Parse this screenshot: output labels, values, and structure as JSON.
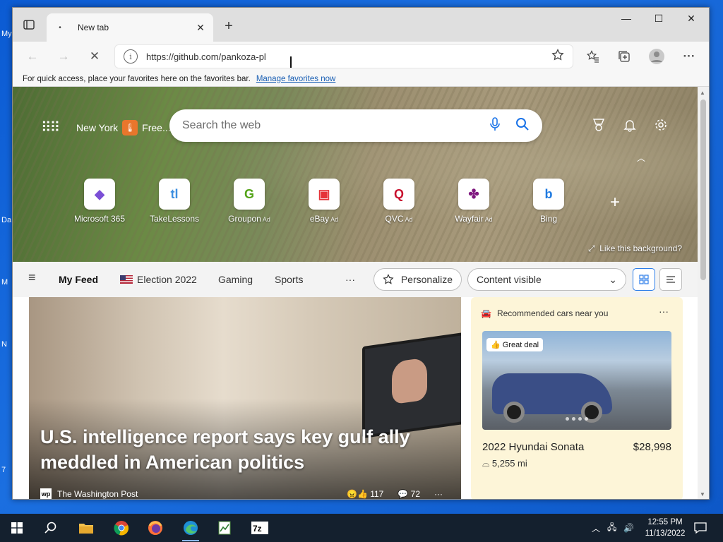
{
  "desktop": {
    "letters": [
      "My",
      "Da",
      "M",
      "N",
      "7"
    ]
  },
  "browser": {
    "tab": {
      "title": "New tab",
      "dot": "•",
      "close": "✕"
    },
    "new_tab": "+",
    "window_controls": {
      "minimize": "—",
      "maximize": "☐",
      "close": "✕"
    },
    "toolbar": {
      "back": "←",
      "forward": "→",
      "stop": "✕",
      "url": "https://github.com/pankoza-pl",
      "info": "i",
      "more": "···"
    },
    "favbar": {
      "text": "For quick access, place your favorites here on the favorites bar.",
      "link": "Manage favorites now"
    }
  },
  "newtab": {
    "weather": {
      "city": "New York",
      "label": "Free..."
    },
    "search_placeholder": "Search the web",
    "tiles": [
      {
        "name": "Microsoft 365",
        "ad": "",
        "glyph": "◆",
        "color": "#7b4fd6"
      },
      {
        "name": "TakeLessons",
        "ad": "",
        "glyph": "tl",
        "color": "#3c8fe0"
      },
      {
        "name": "Groupon",
        "ad": "Ad",
        "glyph": "G",
        "color": "#53a318"
      },
      {
        "name": "eBay",
        "ad": "Ad",
        "glyph": "▣",
        "color": "#e53238"
      },
      {
        "name": "QVC",
        "ad": "Ad",
        "glyph": "Q",
        "color": "#c8102e"
      },
      {
        "name": "Wayfair",
        "ad": "Ad",
        "glyph": "✤",
        "color": "#7f187f"
      },
      {
        "name": "Bing",
        "ad": "",
        "glyph": "b",
        "color": "#1f7ae0"
      }
    ],
    "like_background": "Like this background?",
    "feed": {
      "my_feed": "My Feed",
      "topics": [
        "Election 2022",
        "Gaming",
        "Sports"
      ],
      "more": "···",
      "personalize": "Personalize",
      "content_visible": "Content visible"
    },
    "story": {
      "title": "U.S. intelligence report says key gulf ally meddled in American politics",
      "source": "The Washington Post",
      "source_icon": "wp",
      "reactions": "117",
      "comments": "72",
      "more": "···"
    },
    "car_card": {
      "header": "Recommended cars near you",
      "badge": "Great deal",
      "name": "2022 Hyundai Sonata",
      "price": "$28,998",
      "mileage": "5,255 mi",
      "more": "···"
    }
  },
  "taskbar": {
    "time": "12:55 PM",
    "date": "11/13/2022"
  }
}
